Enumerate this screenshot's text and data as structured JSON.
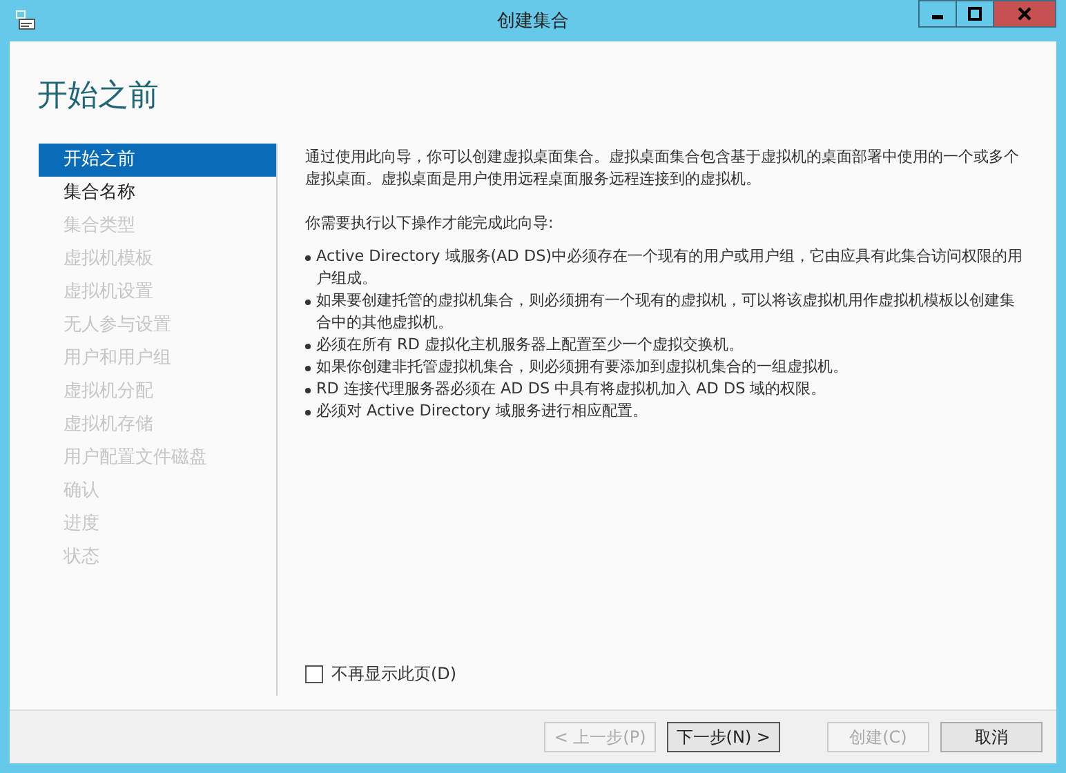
{
  "window": {
    "title": "创建集合"
  },
  "heading": "开始之前",
  "steps": [
    {
      "label": "开始之前",
      "selected": true,
      "disabled": false
    },
    {
      "label": "集合名称",
      "selected": false,
      "disabled": false
    },
    {
      "label": "集合类型",
      "selected": false,
      "disabled": true
    },
    {
      "label": "虚拟机模板",
      "selected": false,
      "disabled": true
    },
    {
      "label": "虚拟机设置",
      "selected": false,
      "disabled": true
    },
    {
      "label": "无人参与设置",
      "selected": false,
      "disabled": true
    },
    {
      "label": "用户和用户组",
      "selected": false,
      "disabled": true
    },
    {
      "label": "虚拟机分配",
      "selected": false,
      "disabled": true
    },
    {
      "label": "虚拟机存储",
      "selected": false,
      "disabled": true
    },
    {
      "label": "用户配置文件磁盘",
      "selected": false,
      "disabled": true
    },
    {
      "label": "确认",
      "selected": false,
      "disabled": true
    },
    {
      "label": "进度",
      "selected": false,
      "disabled": true
    },
    {
      "label": "状态",
      "selected": false,
      "disabled": true
    }
  ],
  "intro": "通过使用此向导，你可以创建虚拟桌面集合。虚拟桌面集合包含基于虚拟机的桌面部署中使用的一个或多个虚拟桌面。虚拟桌面是用户使用远程桌面服务远程连接到的虚拟机。",
  "requirements_title": "你需要执行以下操作才能完成此向导:",
  "requirements": [
    "Active Directory 域服务(AD DS)中必须存在一个现有的用户或用户组，它由应具有此集合访问权限的用户组成。",
    "如果要创建托管的虚拟机集合，则必须拥有一个现有的虚拟机，可以将该虚拟机用作虚拟机模板以创建集合中的其他虚拟机。",
    "必须在所有 RD 虚拟化主机服务器上配置至少一个虚拟交换机。",
    "如果你创建非托管虚拟机集合，则必须拥有要添加到虚拟机集合的一组虚拟机。",
    "RD 连接代理服务器必须在 AD DS 中具有将虚拟机加入 AD DS 域的权限。",
    "必须对 Active Directory 域服务进行相应配置。"
  ],
  "dont_show_again": {
    "label": "不再显示此页(D)",
    "checked": false
  },
  "buttons": [
    {
      "label": "< 上一步(P)",
      "disabled": true,
      "default": false
    },
    {
      "label": "下一步(N) >",
      "disabled": false,
      "default": true
    },
    {
      "label": "创建(C)",
      "disabled": true,
      "default": false
    },
    {
      "label": "取消",
      "disabled": false,
      "default": false
    }
  ]
}
